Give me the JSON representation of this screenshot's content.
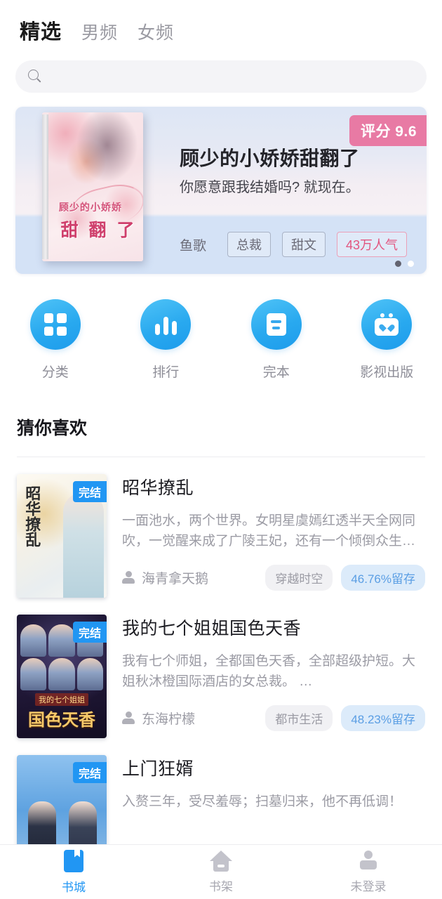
{
  "header": {
    "tabs": [
      {
        "label": "精选",
        "active": true
      },
      {
        "label": "男频",
        "active": false
      },
      {
        "label": "女频",
        "active": false
      }
    ]
  },
  "search": {
    "placeholder": "",
    "value": "",
    "icon": "search-icon"
  },
  "banner": {
    "rating_label": "评分 9.6",
    "title": "顾少的小娇娇甜翻了",
    "subtitle": "你愿意跟我结婚吗? 就现在。",
    "author": "鱼歌",
    "tags": [
      "总裁",
      "甜文"
    ],
    "hot_tag": "43万人气",
    "cover_text_top": "顾少的小娇娇",
    "cover_text_bottom": "甜 翻 了",
    "dots": 2,
    "active_dot": 0,
    "accent_pink": "#e87aa4",
    "hot_color": "#e2557f"
  },
  "quick_actions": [
    {
      "label": "分类",
      "icon": "grid-icon"
    },
    {
      "label": "排行",
      "icon": "bar-chart-icon"
    },
    {
      "label": "完本",
      "icon": "document-icon"
    },
    {
      "label": "影视出版",
      "icon": "shopping-bag-heart-icon"
    }
  ],
  "recommend": {
    "section_title": "猜你喜欢",
    "books": [
      {
        "title": "昭华撩乱",
        "badge": "完结",
        "description": "一面池水，两个世界。女明星虞嫣红透半天全网同吹，一觉醒来成了广陵王妃，还有一个倾倒众生…",
        "author": "海青拿天鹅",
        "category_tag": "穿越时空",
        "retention_tag": "46.76%留存",
        "cover_text": "昭华撩乱"
      },
      {
        "title": "我的七个姐姐国色天香",
        "badge": "完结",
        "description": "我有七个师姐，全都国色天香，全部超级护短。大姐秋沐橙国际酒店的女总裁。 …",
        "author": "东海柠檬",
        "category_tag": "都市生活",
        "retention_tag": "48.23%留存",
        "cover_text_small": "我的七个姐姐",
        "cover_text": "国色天香"
      },
      {
        "title": "上门狂婿",
        "badge": "完结",
        "description": "入赘三年，受尽羞辱；扫墓归来，他不再低调！",
        "author": "",
        "category_tag": "",
        "retention_tag": "",
        "cover_text": ""
      }
    ]
  },
  "bottom_nav": [
    {
      "label": "书城",
      "icon": "book-icon",
      "active": true
    },
    {
      "label": "书架",
      "icon": "home-icon",
      "active": false
    },
    {
      "label": "未登录",
      "icon": "user-icon",
      "active": false
    }
  ]
}
